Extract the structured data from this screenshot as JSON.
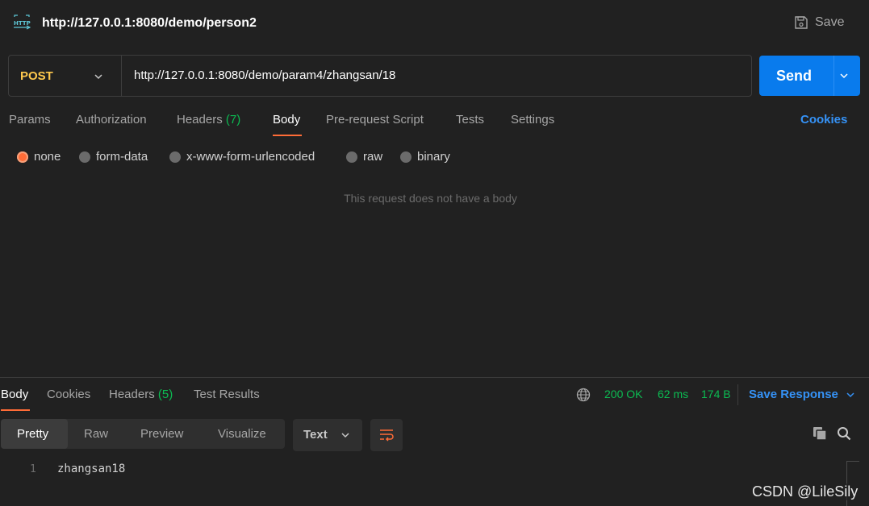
{
  "header": {
    "icon": "http-icon",
    "title": "http://127.0.0.1:8080/demo/person2",
    "save_label": "Save"
  },
  "request": {
    "method": "POST",
    "url": "http://127.0.0.1:8080/demo/param4/zhangsan/18",
    "send_label": "Send"
  },
  "request_tabs": {
    "params": "Params",
    "authorization": "Authorization",
    "headers": "Headers",
    "headers_count": "(7)",
    "body": "Body",
    "prerequest": "Pre-request Script",
    "tests": "Tests",
    "settings": "Settings",
    "cookies": "Cookies"
  },
  "body_options": {
    "none": "none",
    "form_data": "form-data",
    "urlencoded": "x-www-form-urlencoded",
    "raw": "raw",
    "binary": "binary",
    "selected": "none"
  },
  "empty_body_message": "This request does not have a body",
  "response_tabs": {
    "body": "Body",
    "cookies": "Cookies",
    "headers": "Headers",
    "headers_count": "(5)",
    "test_results": "Test Results"
  },
  "response_status": {
    "status": "200 OK",
    "time": "62 ms",
    "size": "174 B",
    "save_response": "Save Response"
  },
  "view_modes": {
    "pretty": "Pretty",
    "raw": "Raw",
    "preview": "Preview",
    "visualize": "Visualize",
    "format": "Text"
  },
  "response_body": {
    "line_number": "1",
    "content": "zhangsan18"
  },
  "watermark": "CSDN @LileSily",
  "colors": {
    "background": "#212121",
    "accent_orange": "#ff6c37",
    "method_yellow": "#ffc94d",
    "send_blue": "#097bed",
    "link_blue": "#3592f6",
    "status_green": "#0cbb52"
  }
}
